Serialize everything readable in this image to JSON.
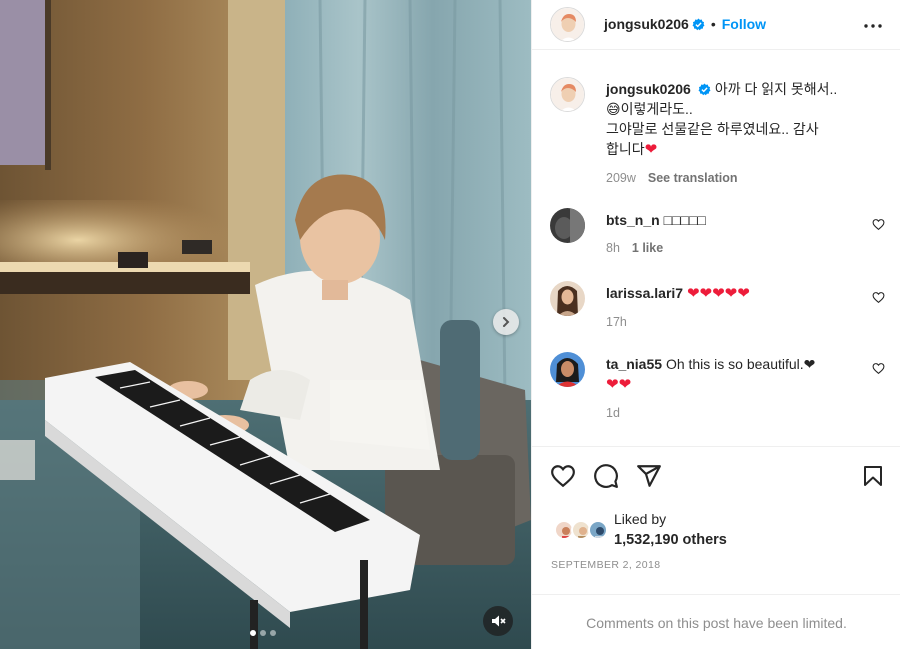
{
  "post": {
    "username": "jongsuk0206",
    "separator": "•",
    "follow_label": "Follow",
    "caption_lines": [
      "아까 다 읽지 못해서..",
      "😅이렇게라도..",
      "그야말로 선물같은 하루였네요.. 감사",
      "합니다"
    ],
    "caption_heart": "❤",
    "caption_age": "209w",
    "see_translation": "See translation"
  },
  "comments": [
    {
      "username": "bts_n_n",
      "text": "□□□□□",
      "age": "8h",
      "likes": "1 like"
    },
    {
      "username": "larissa.lari7",
      "text": "❤❤❤❤❤",
      "age": "17h",
      "likes": ""
    },
    {
      "username": "ta_nia55",
      "text": "Oh this is so beautiful.❤",
      "text2": "❤❤",
      "age": "1d",
      "likes": ""
    }
  ],
  "engagement": {
    "liked_by": "Liked by",
    "count": "1,532,190 others",
    "date": "SEPTEMBER 2, 2018",
    "comments_limited": "Comments on this post have been limited."
  },
  "icons": [
    "verified-icon",
    "more-icon",
    "heart-icon",
    "comment-icon",
    "share-icon",
    "bookmark-icon",
    "chevron-right-icon",
    "mute-icon"
  ],
  "colors": {
    "accent": "#0095f6",
    "heart": "#ed1c3a",
    "muted": "#8e8e8e"
  }
}
